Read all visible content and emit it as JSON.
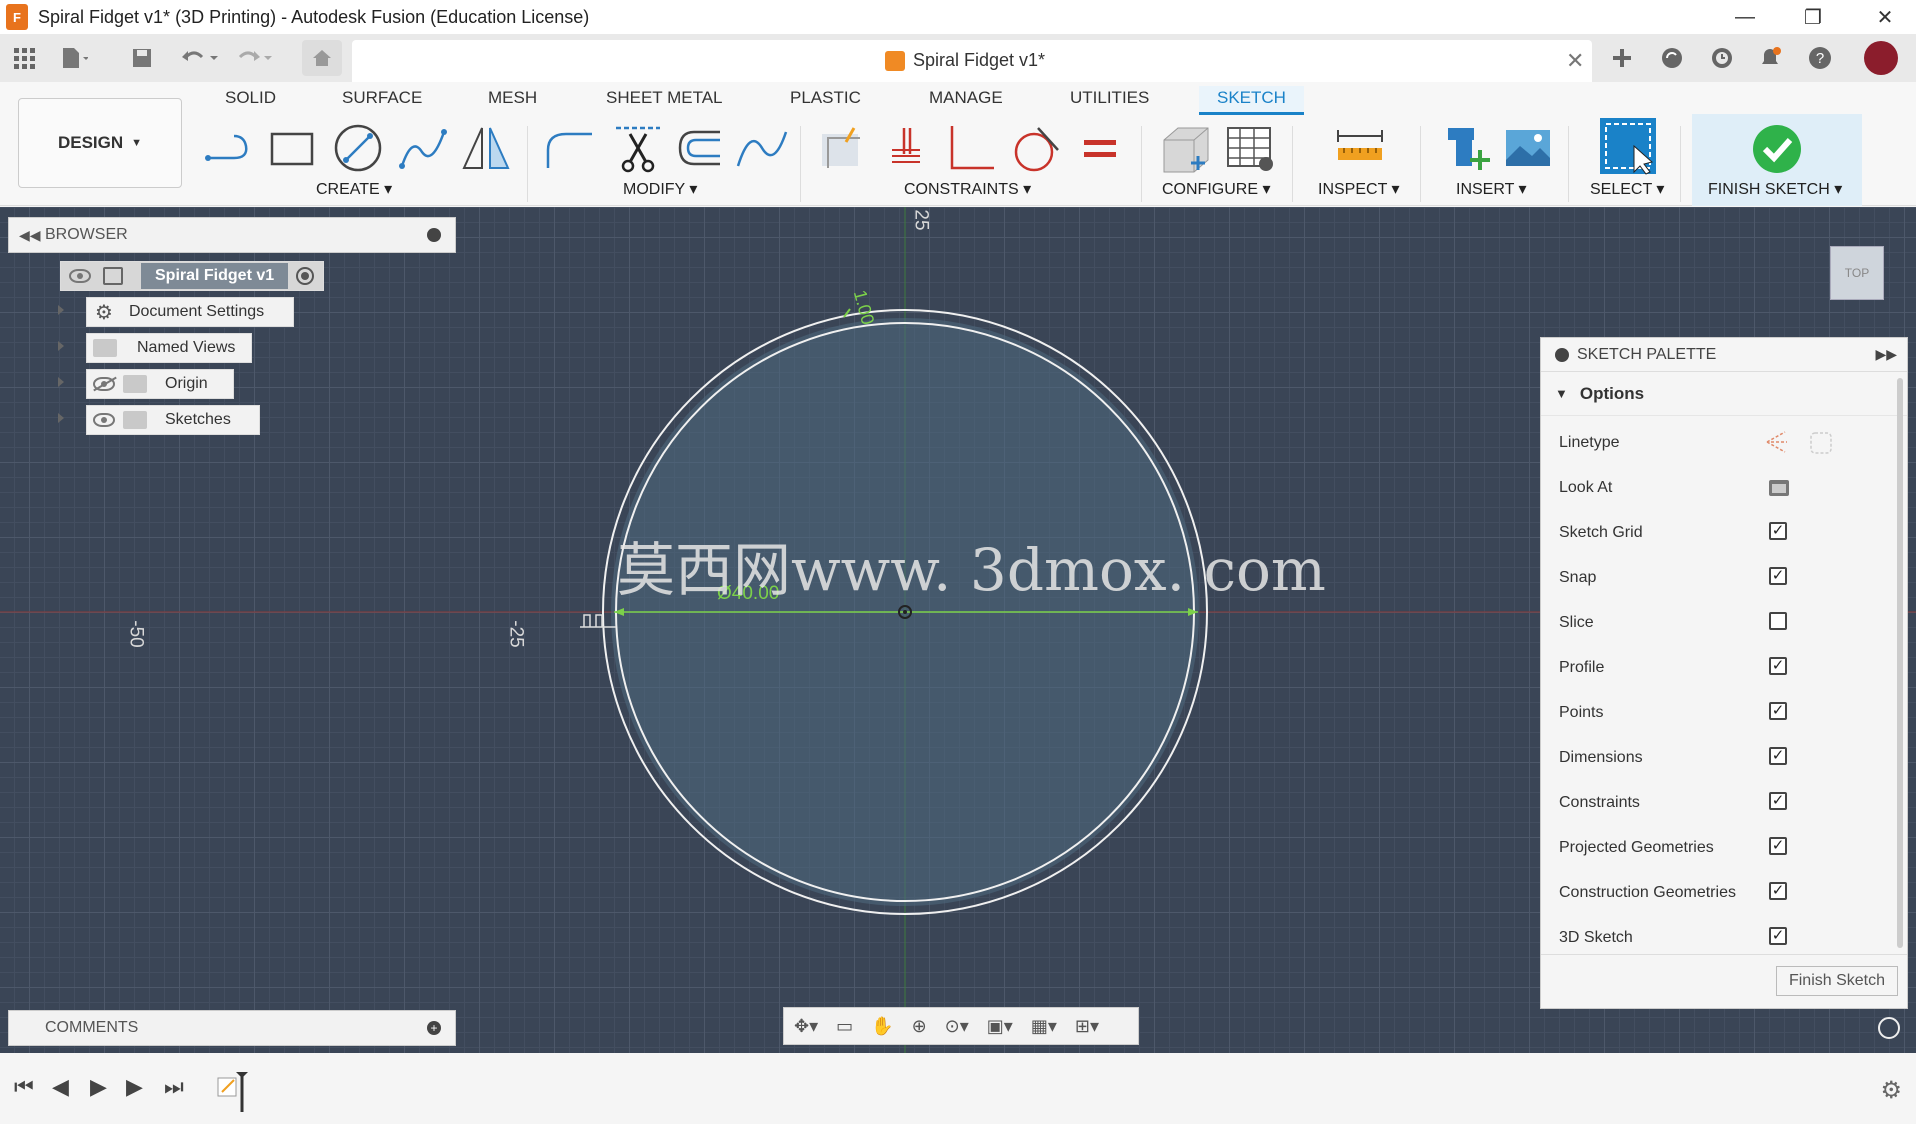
{
  "window": {
    "title": "Spiral Fidget v1* (3D Printing) - Autodesk Fusion (Education License)",
    "logo_letter": "F",
    "minimize": "—",
    "restore": "❐",
    "close": "✕"
  },
  "doc_tab": {
    "title": "Spiral Fidget v1*",
    "close": "✕"
  },
  "ribbon": {
    "workspace": "DESIGN",
    "tabs": [
      "SOLID",
      "SURFACE",
      "MESH",
      "SHEET METAL",
      "PLASTIC",
      "MANAGE",
      "UTILITIES",
      "SKETCH"
    ],
    "active_tab": "SKETCH",
    "groups": [
      "CREATE",
      "MODIFY",
      "CONSTRAINTS",
      "CONFIGURE",
      "INSPECT",
      "INSERT",
      "SELECT",
      "FINISH SKETCH"
    ],
    "accent": "#1a82c8"
  },
  "browser": {
    "title": "BROWSER",
    "root": "Spiral Fidget v1",
    "items": [
      "Document Settings",
      "Named Views",
      "Origin",
      "Sketches"
    ]
  },
  "comments": {
    "title": "COMMENTS"
  },
  "canvas": {
    "dimension": "Ø40.00",
    "offset_label": "1.00",
    "axis_labels": [
      "-50",
      "-25",
      "25"
    ],
    "watermark": "莫西网www. 3dmox. com",
    "viewcube": "TOP"
  },
  "palette": {
    "title": "SKETCH PALETTE",
    "section": "Options",
    "rows": [
      {
        "label": "Linetype",
        "type": "icons"
      },
      {
        "label": "Look At",
        "type": "icon"
      },
      {
        "label": "Sketch Grid",
        "checked": true
      },
      {
        "label": "Snap",
        "checked": true
      },
      {
        "label": "Slice",
        "checked": false
      },
      {
        "label": "Profile",
        "checked": true
      },
      {
        "label": "Points",
        "checked": true
      },
      {
        "label": "Dimensions",
        "checked": true
      },
      {
        "label": "Constraints",
        "checked": true
      },
      {
        "label": "Projected Geometries",
        "checked": true
      },
      {
        "label": "Construction Geometries",
        "checked": true
      },
      {
        "label": "3D Sketch",
        "checked": true
      }
    ],
    "finish_button": "Finish Sketch"
  }
}
